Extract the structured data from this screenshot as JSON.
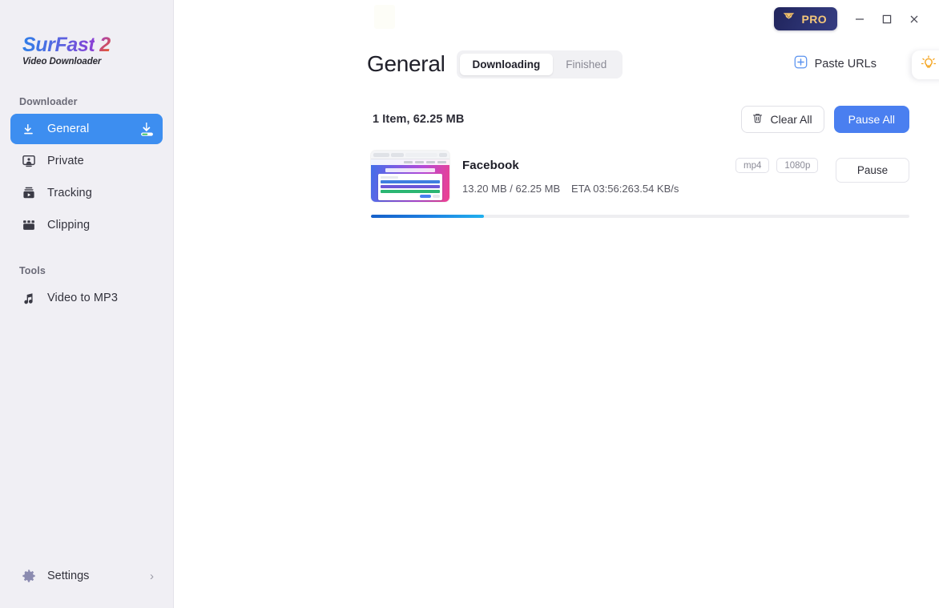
{
  "brand": {
    "name_main": "SurFast",
    "name_two": "2",
    "tagline": "Video Downloader"
  },
  "sidebar": {
    "downloader_section_label": "Downloader",
    "tools_section_label": "Tools",
    "items": [
      {
        "label": "General",
        "icon": "download-arrow-icon",
        "active": true,
        "badge": "download-progress-icon"
      },
      {
        "label": "Private",
        "icon": "private-person-icon",
        "active": false
      },
      {
        "label": "Tracking",
        "icon": "tracking-video-icon",
        "active": false
      },
      {
        "label": "Clipping",
        "icon": "clipping-film-icon",
        "active": false
      }
    ],
    "tools": [
      {
        "label": "Video to MP3",
        "icon": "music-note-icon"
      }
    ],
    "settings": {
      "label": "Settings",
      "icon": "gear-icon",
      "chevron": "›"
    }
  },
  "titlebar": {
    "pro_label": "PRO",
    "pro_icon": "crown-gem-icon",
    "minimize": "–",
    "maximize": "□",
    "close": "✕"
  },
  "header": {
    "page_title": "General",
    "tabs": [
      {
        "label": "Downloading",
        "active": true
      },
      {
        "label": "Finished",
        "active": false
      }
    ],
    "paste_urls_label": "Paste URLs",
    "paste_urls_icon": "plus-square-icon",
    "bulb_icon": "lightbulb-icon"
  },
  "toolbar": {
    "count_text": "1 Item, 62.25 MB",
    "clear_all_label": "Clear All",
    "clear_all_icon": "trash-icon",
    "pause_all_label": "Pause All"
  },
  "downloads": [
    {
      "title": "Facebook",
      "thumbnail": "facebook-page-thumbnail",
      "downloaded": "13.20 MB / 62.25 MB",
      "eta": "ETA 03:56:26",
      "speed": "3.54 KB/s",
      "format_badge": "mp4",
      "quality_badge": "1080p",
      "action_label": "Pause",
      "progress_percent": 21
    }
  ],
  "colors": {
    "accent_blue": "#4a7ff0",
    "sidebar_active": "#3d8ef0",
    "sidebar_bg": "#f0eff4",
    "pro_navy": "#252a5e",
    "pro_gold": "#f4c77a",
    "progress_start": "#1560c9",
    "progress_end": "#20b0ee",
    "bulb_amber": "#f5a623"
  }
}
